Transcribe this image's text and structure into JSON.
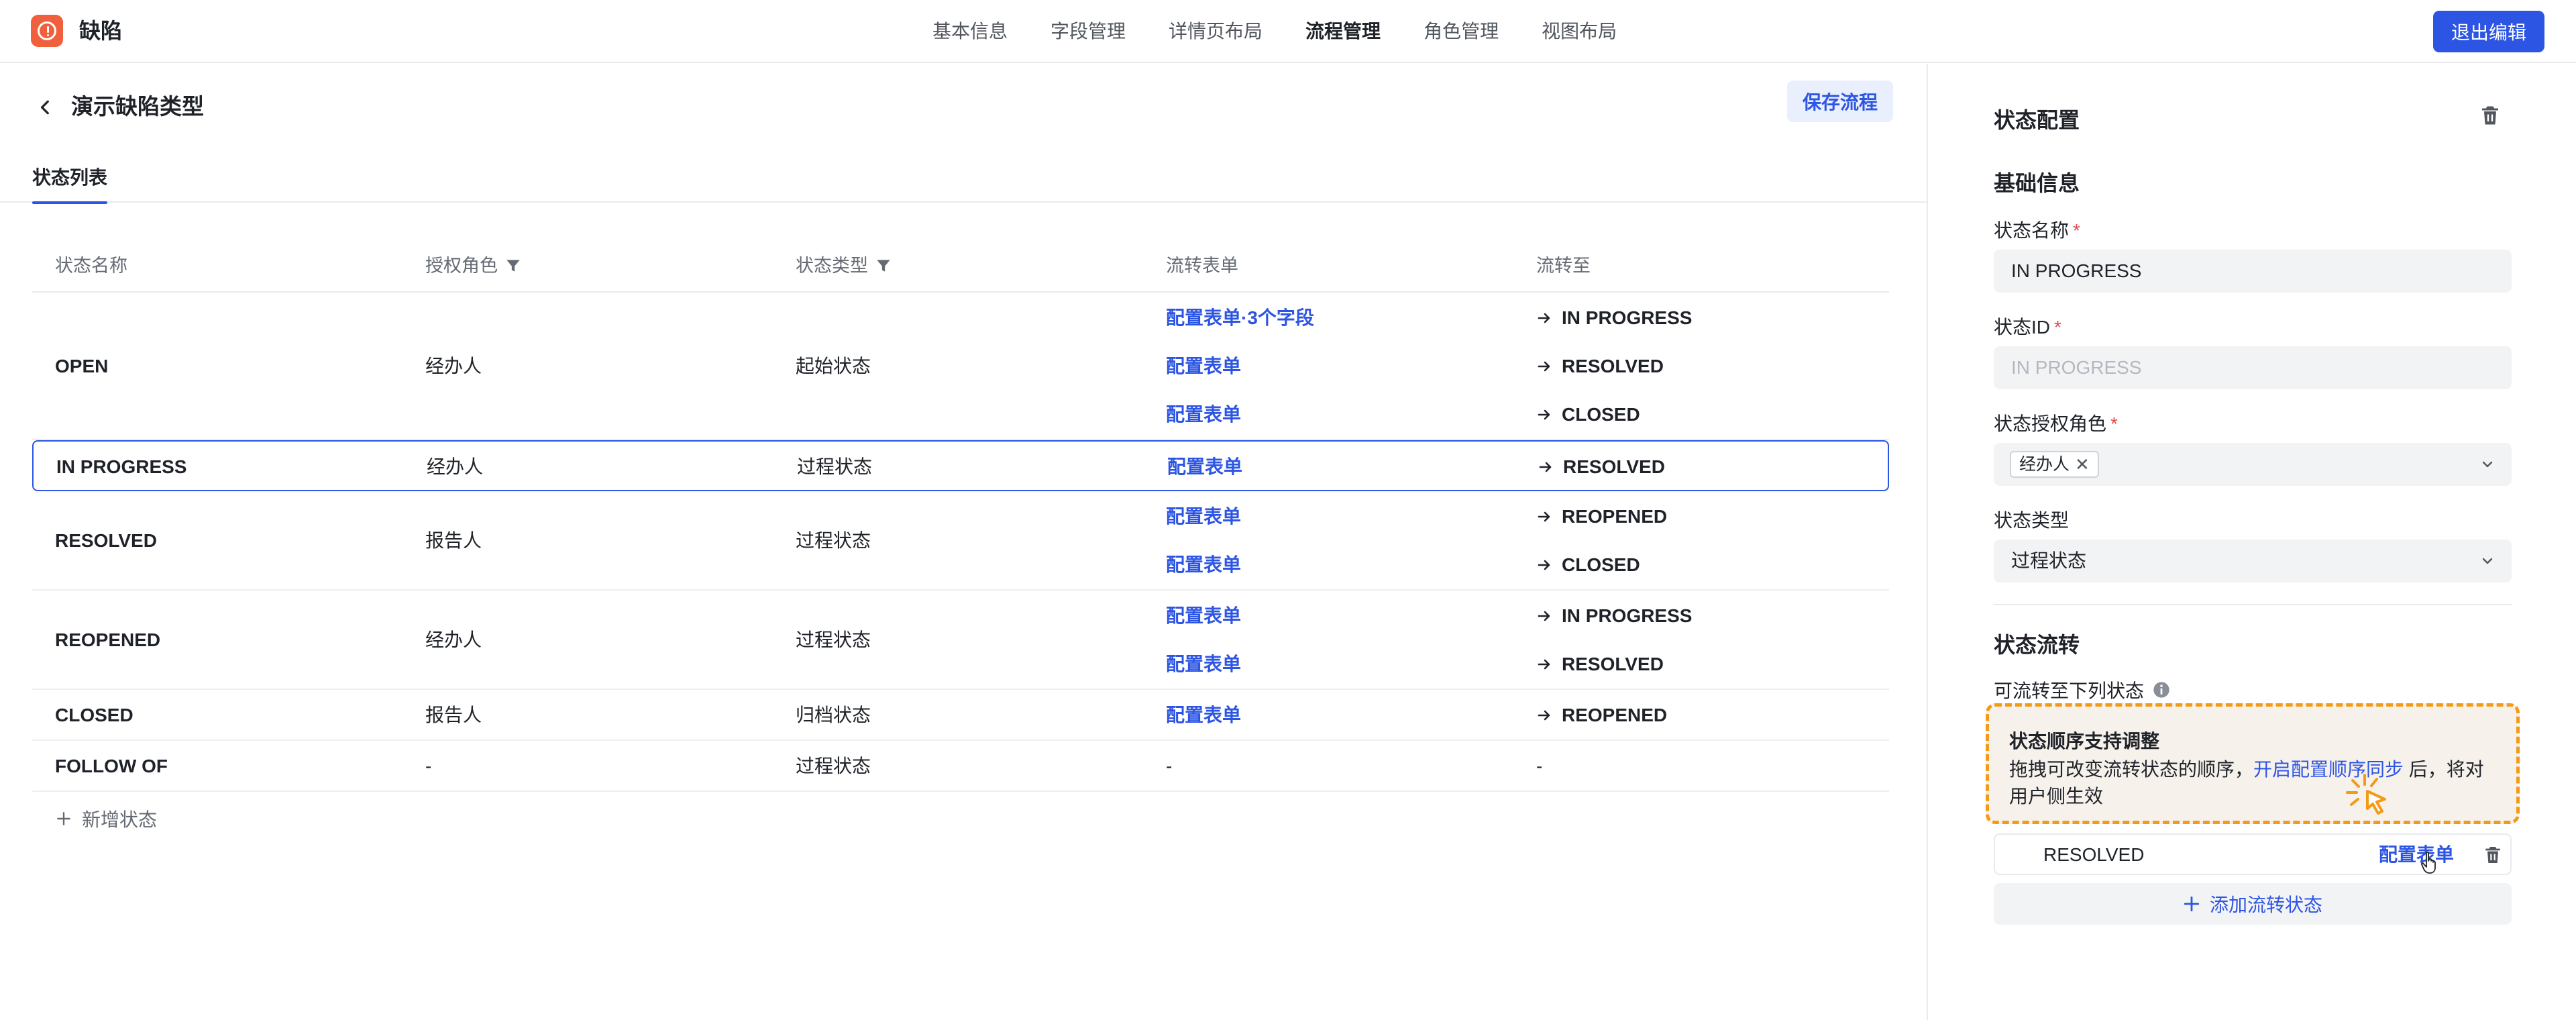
{
  "app": {
    "title": "缺陷",
    "exit_label": "退出编辑"
  },
  "nav": [
    {
      "label": "基本信息",
      "active": false
    },
    {
      "label": "字段管理",
      "active": false
    },
    {
      "label": "详情页布局",
      "active": false
    },
    {
      "label": "流程管理",
      "active": true
    },
    {
      "label": "角色管理",
      "active": false
    },
    {
      "label": "视图布局",
      "active": false
    }
  ],
  "page": {
    "title": "演示缺陷类型",
    "save_label": "保存流程",
    "tab_label": "状态列表"
  },
  "table": {
    "headers": [
      "状态名称",
      "授权角色",
      "状态类型",
      "流转表单",
      "流转至"
    ],
    "rows": [
      {
        "name": "OPEN",
        "role": "经办人",
        "type": "起始状态",
        "selected": false,
        "flows": [
          {
            "form": "配置表单·3个字段",
            "to": "IN PROGRESS"
          },
          {
            "form": "配置表单",
            "to": "RESOLVED"
          },
          {
            "form": "配置表单",
            "to": "CLOSED"
          }
        ]
      },
      {
        "name": "IN PROGRESS",
        "role": "经办人",
        "type": "过程状态",
        "selected": true,
        "flows": [
          {
            "form": "配置表单",
            "to": "RESOLVED"
          }
        ]
      },
      {
        "name": "RESOLVED",
        "role": "报告人",
        "type": "过程状态",
        "selected": false,
        "flows": [
          {
            "form": "配置表单",
            "to": "REOPENED"
          },
          {
            "form": "配置表单",
            "to": "CLOSED"
          }
        ]
      },
      {
        "name": "REOPENED",
        "role": "经办人",
        "type": "过程状态",
        "selected": false,
        "flows": [
          {
            "form": "配置表单",
            "to": "IN PROGRESS"
          },
          {
            "form": "配置表单",
            "to": "RESOLVED"
          }
        ]
      },
      {
        "name": "CLOSED",
        "role": "报告人",
        "type": "归档状态",
        "selected": false,
        "flows": [
          {
            "form": "配置表单",
            "to": "REOPENED"
          }
        ]
      },
      {
        "name": "FOLLOW OF",
        "role": "-",
        "type": "过程状态",
        "selected": false,
        "flows": [
          {
            "form": "-",
            "to": "-",
            "plain": true
          }
        ]
      }
    ],
    "add_label": "新增状态"
  },
  "panel": {
    "title": "状态配置",
    "basic_title": "基础信息",
    "name_label": "状态名称",
    "name_value": "IN PROGRESS",
    "id_label": "状态ID",
    "id_value": "IN PROGRESS",
    "role_label": "状态授权角色",
    "role_tag": "经办人",
    "type_label": "状态类型",
    "type_value": "过程状态",
    "flow_title": "状态流转",
    "flow_sublabel": "可流转至下列状态",
    "tip_title": "状态顺序支持调整",
    "tip_text_1": "拖拽可改变流转状态的顺序，",
    "tip_link": "开启配置顺序同步",
    "tip_text_2": " 后，将对用户侧生效",
    "flow_item_name": "RESOLVED",
    "flow_item_link": "配置表单",
    "add_flow_label": "添加流转状态"
  },
  "colors": {
    "accent": "#2d55e3",
    "logo": "#f0603c",
    "tip_border": "#f39a16",
    "required": "#e5484d"
  },
  "icons": [
    "app-logo-icon",
    "back-arrow-icon",
    "filter-icon",
    "arrow-right-icon",
    "plus-icon",
    "trash-icon",
    "chevron-down-icon",
    "close-icon",
    "info-icon",
    "click-cursor-icon",
    "hand-cursor-icon"
  ]
}
